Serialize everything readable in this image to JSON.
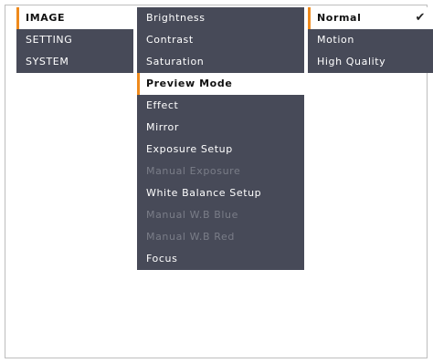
{
  "main_menu": {
    "items": [
      {
        "label": "IMAGE",
        "selected": true
      },
      {
        "label": "SETTING",
        "selected": false
      },
      {
        "label": "SYSTEM",
        "selected": false
      }
    ]
  },
  "sub_menu": {
    "items": [
      {
        "label": "Brightness",
        "state": "enabled"
      },
      {
        "label": "Contrast",
        "state": "enabled"
      },
      {
        "label": "Saturation",
        "state": "enabled"
      },
      {
        "label": "Preview Mode",
        "state": "selected"
      },
      {
        "label": "Effect",
        "state": "enabled"
      },
      {
        "label": "Mirror",
        "state": "enabled"
      },
      {
        "label": "Exposure Setup",
        "state": "enabled"
      },
      {
        "label": "Manual Exposure",
        "state": "disabled"
      },
      {
        "label": "White Balance Setup",
        "state": "enabled"
      },
      {
        "label": "Manual W.B Blue",
        "state": "disabled"
      },
      {
        "label": "Manual W.B Red",
        "state": "disabled"
      },
      {
        "label": "Focus",
        "state": "enabled"
      }
    ]
  },
  "options_menu": {
    "items": [
      {
        "label": "Normal",
        "selected": true,
        "check": "✔"
      },
      {
        "label": "Motion",
        "selected": false
      },
      {
        "label": "High Quality",
        "selected": false
      }
    ]
  },
  "colors": {
    "menu_bg": "#474a58",
    "accent": "#ef8a1c",
    "disabled_text": "#7a7d88",
    "selected_bg": "#ffffff"
  }
}
